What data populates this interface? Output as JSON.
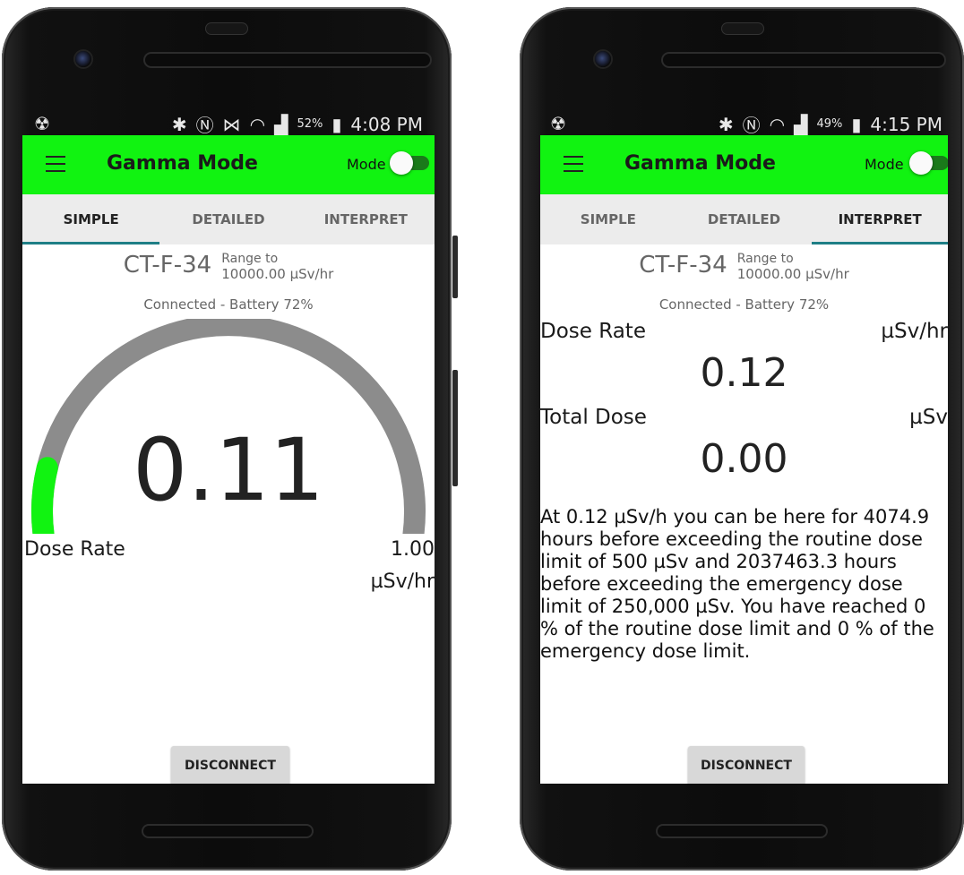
{
  "status_left": {
    "time": "4:08 PM",
    "battery_pct": "52%"
  },
  "status_right": {
    "time": "4:15 PM",
    "battery_pct": "49%"
  },
  "app": {
    "title": "Gamma Mode",
    "mode_label": "Mode",
    "tabs": [
      "SIMPLE",
      "DETAILED",
      "INTERPRET"
    ],
    "accent_color": "#11f311"
  },
  "device": {
    "name": "CT-F-34",
    "range_label": "Range to",
    "range_value": "10000.00 µSv/hr",
    "connection": "Connected - Battery 72%"
  },
  "simple_view": {
    "active_tab": "SIMPLE",
    "dose_rate_value": "0.11",
    "dose_rate_label": "Dose Rate",
    "gauge_max": "1.00",
    "gauge_unit": "µSv/hr",
    "gauge_fraction": 0.11
  },
  "interpret_view": {
    "active_tab": "INTERPRET",
    "dose_rate_label": "Dose Rate",
    "dose_rate_unit": "µSv/hr",
    "dose_rate_value": "0.12",
    "total_dose_label": "Total Dose",
    "total_dose_unit": "µSv",
    "total_dose_value": "0.00",
    "interpretation": "At 0.12 µSv/h you can be here for 4074.9 hours before exceeding the routine dose limit of 500 µSv and 2037463.3 hours before exceeding the emergency dose limit of 250,000 µSv. You have reached 0 % of the routine dose limit and 0 % of the emergency dose limit."
  },
  "buttons": {
    "disconnect": "DISCONNECT"
  }
}
